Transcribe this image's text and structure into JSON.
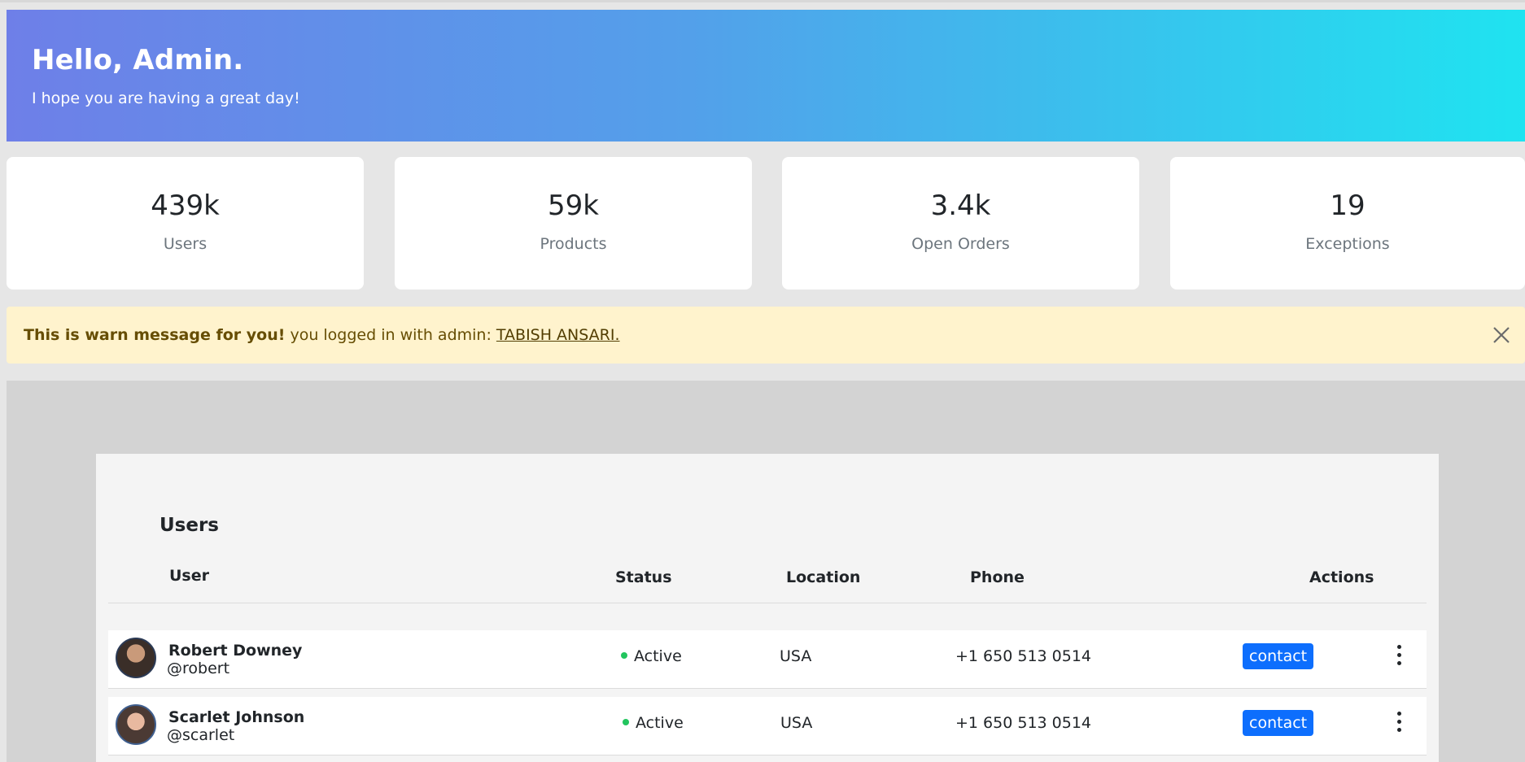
{
  "header": {
    "greeting": "Hello, Admin.",
    "subtitle": "I hope you are having a great day!"
  },
  "stats": [
    {
      "value": "439k",
      "label": "Users"
    },
    {
      "value": "59k",
      "label": "Products"
    },
    {
      "value": "3.4k",
      "label": "Open Orders"
    },
    {
      "value": "19",
      "label": "Exceptions"
    }
  ],
  "alert": {
    "strong": "This is warn message for you!",
    "text": " you logged in with admin: ",
    "admin_name": "TABISH ANSARI."
  },
  "users_table": {
    "title": "Users",
    "columns": [
      "User",
      "Status",
      "Location",
      "Phone",
      "Actions"
    ],
    "rows": [
      {
        "name": "Robert Downey",
        "handle": "@robert",
        "status": "Active",
        "location": "USA",
        "phone": "+1 650 513 0514",
        "action_label": "contact"
      },
      {
        "name": "Scarlet Johnson",
        "handle": "@scarlet",
        "status": "Active",
        "location": "USA",
        "phone": "+1 650 513 0514",
        "action_label": "contact"
      }
    ]
  },
  "colors": {
    "hero_gradient_start": "#6e7fe8",
    "hero_gradient_end": "#1fe3f0",
    "alert_bg": "#fff3cd",
    "primary_button": "#0d6efd",
    "status_active": "#22c55e"
  },
  "icons": {
    "alert_close": "close-icon",
    "row_menu": "more-vertical-icon"
  }
}
